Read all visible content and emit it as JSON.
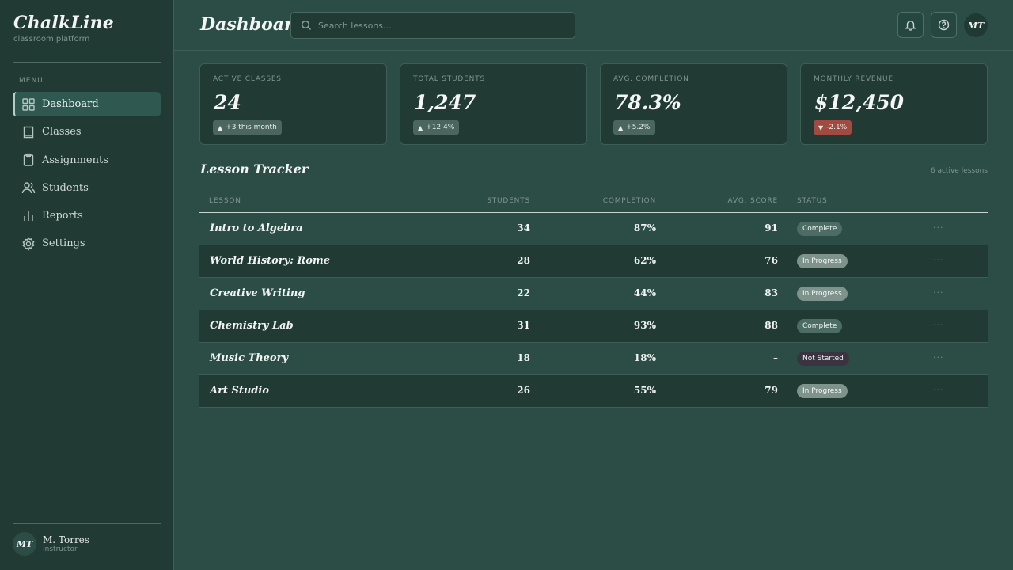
{
  "brand": {
    "name": "ChalkLine",
    "subtitle": "classroom platform"
  },
  "sidebar": {
    "menu_label": "MENU",
    "items": [
      {
        "label": "Dashboard",
        "icon": "grid-icon",
        "active": true
      },
      {
        "label": "Classes",
        "icon": "book-icon",
        "active": false
      },
      {
        "label": "Assignments",
        "icon": "clipboard-icon",
        "active": false
      },
      {
        "label": "Students",
        "icon": "users-icon",
        "active": false
      },
      {
        "label": "Reports",
        "icon": "bar-chart-icon",
        "active": false
      },
      {
        "label": "Settings",
        "icon": "gear-icon",
        "active": false
      }
    ],
    "user": {
      "initials": "MT",
      "name": "M. Torres",
      "role": "Instructor"
    }
  },
  "header": {
    "title": "Dashboard",
    "search_placeholder": "Search lessons...",
    "avatar_initials": "MT"
  },
  "stats": [
    {
      "label": "ACTIVE CLASSES",
      "value": "24",
      "badge": "+3 this month",
      "trend": "up"
    },
    {
      "label": "TOTAL STUDENTS",
      "value": "1,247",
      "badge": "+12.4%",
      "trend": "up"
    },
    {
      "label": "AVG. COMPLETION",
      "value": "78.3%",
      "badge": "+5.2%",
      "trend": "up"
    },
    {
      "label": "MONTHLY REVENUE",
      "value": "$12,450",
      "badge": "-2.1%",
      "trend": "down"
    }
  ],
  "tracker": {
    "title": "Lesson Tracker",
    "note": "6 active lessons",
    "columns": [
      "LESSON",
      "STUDENTS",
      "COMPLETION",
      "AVG. SCORE",
      "STATUS"
    ],
    "rows": [
      {
        "lesson": "Intro to Algebra",
        "students": "34",
        "completion": "87%",
        "score": "91",
        "status": "Complete",
        "status_kind": "complete"
      },
      {
        "lesson": "World History: Rome",
        "students": "28",
        "completion": "62%",
        "score": "76",
        "status": "In Progress",
        "status_kind": "progress"
      },
      {
        "lesson": "Creative Writing",
        "students": "22",
        "completion": "44%",
        "score": "83",
        "status": "In Progress",
        "status_kind": "progress"
      },
      {
        "lesson": "Chemistry Lab",
        "students": "31",
        "completion": "93%",
        "score": "88",
        "status": "Complete",
        "status_kind": "complete"
      },
      {
        "lesson": "Music Theory",
        "students": "18",
        "completion": "18%",
        "score": "–",
        "status": "Not Started",
        "status_kind": "notstarted"
      },
      {
        "lesson": "Art Studio",
        "students": "26",
        "completion": "55%",
        "score": "79",
        "status": "In Progress",
        "status_kind": "progress"
      }
    ],
    "more_label": "···"
  },
  "colors": {
    "background": "#2b4d45",
    "sidebar": "#213a34",
    "badge_negative": "#a14a42"
  }
}
